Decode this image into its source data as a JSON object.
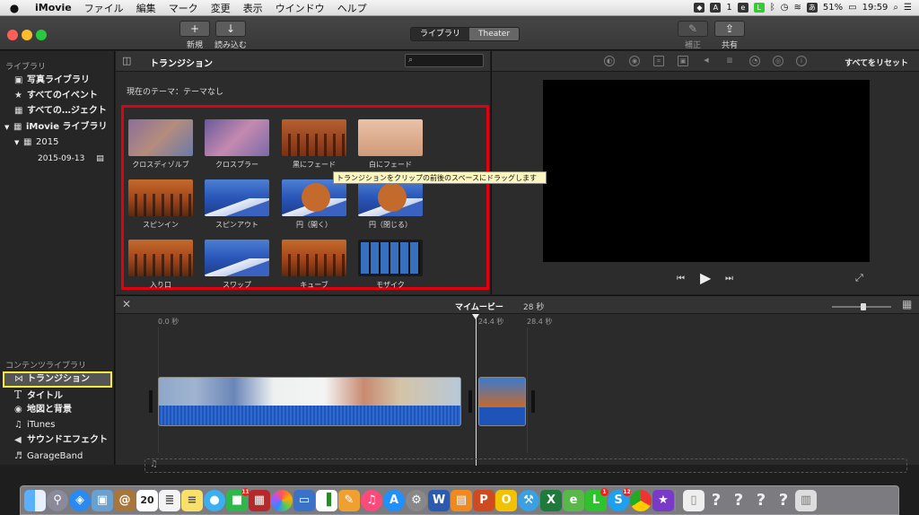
{
  "menubar": {
    "app": "iMovie",
    "items": [
      "ファイル",
      "編集",
      "マーク",
      "変更",
      "表示",
      "ウインドウ",
      "ヘルプ"
    ],
    "status_icons": [
      "dropbox-icon",
      "adobe-icon",
      "evernote-icon",
      "line-icon",
      "bluetooth-icon",
      "time-machine-icon",
      "wifi-icon",
      "input-method-icon"
    ],
    "adobe_count": "1",
    "input_method": "あ",
    "battery": "51%",
    "clock": "19:59"
  },
  "toolbar": {
    "new_label": "新規",
    "import_label": "読み込む",
    "tab_library": "ライブラリ",
    "tab_theater": "Theater",
    "adjust_label": "補正",
    "share_label": "共有",
    "new_icon": "+",
    "import_icon": "↓",
    "adjust_icon": "✎",
    "share_icon": "⇪"
  },
  "sidebar": {
    "section_library": "ライブラリ",
    "items": [
      {
        "icon": "photos-icon",
        "glyph": "▣",
        "label": "写真ライブラリ"
      },
      {
        "icon": "star-icon",
        "glyph": "★",
        "label": "すべてのイベント"
      },
      {
        "icon": "film-icon",
        "glyph": "▦",
        "label": "すべての…ジェクト"
      },
      {
        "icon": "grid-icon",
        "glyph": "▦",
        "label": "iMovie ライブラリ"
      }
    ],
    "year": "2015",
    "event": "2015-09-13",
    "section_content": "コンテンツライブラリ",
    "content_items": [
      {
        "glyph": "⋈",
        "label": "トランジション"
      },
      {
        "glyph": "T",
        "label": "タイトル"
      },
      {
        "glyph": "◉",
        "label": "地図と背景"
      },
      {
        "glyph": "♫",
        "label": "iTunes"
      },
      {
        "glyph": "◀",
        "label": "サウンドエフェクト"
      },
      {
        "glyph": "♬",
        "label": "GarageBand"
      }
    ]
  },
  "browser": {
    "title": "トランジション",
    "search_placeholder": "",
    "theme": "現在のテーマ：テーマなし",
    "transitions": [
      "クロスディゾルブ",
      "クロスブラー",
      "黒にフェード",
      "白にフェード",
      "スピンイン",
      "スピンアウト",
      "円（開く）",
      "円（閉じる）",
      "入り口",
      "スワップ",
      "キューブ",
      "モザイク"
    ],
    "tooltip": "トランジションをクリップの前後のスペースにドラッグします"
  },
  "viewer": {
    "reset_label": "すべてをリセット"
  },
  "timeline": {
    "title": "マイムービー",
    "duration": "28 秒",
    "time_start": "0.0 秒",
    "time_mid": "24.4 秒",
    "time_end": "28.4 秒"
  },
  "dock": {
    "apps": [
      "finder",
      "launchpad",
      "safari",
      "preview",
      "contacts",
      "calendar",
      "reminders",
      "notes",
      "messages",
      "facetime",
      "photo-booth",
      "photos",
      "keynote",
      "numbers",
      "pages",
      "itunes",
      "app-store",
      "system-prefs",
      "word",
      "ibooks",
      "powerpoint",
      "outlook",
      "xcode",
      "excel",
      "evernote",
      "line",
      "skype",
      "chrome",
      "imovie",
      "document",
      "unknown1",
      "unknown2",
      "unknown3",
      "unknown4",
      "trash"
    ],
    "calendar_day": "20",
    "facetime_badge": "11",
    "line_badge": "1",
    "skype_badge": "12"
  },
  "colors": {
    "highlight_box": "#e00012",
    "selection_outline": "#ffeb3b"
  }
}
